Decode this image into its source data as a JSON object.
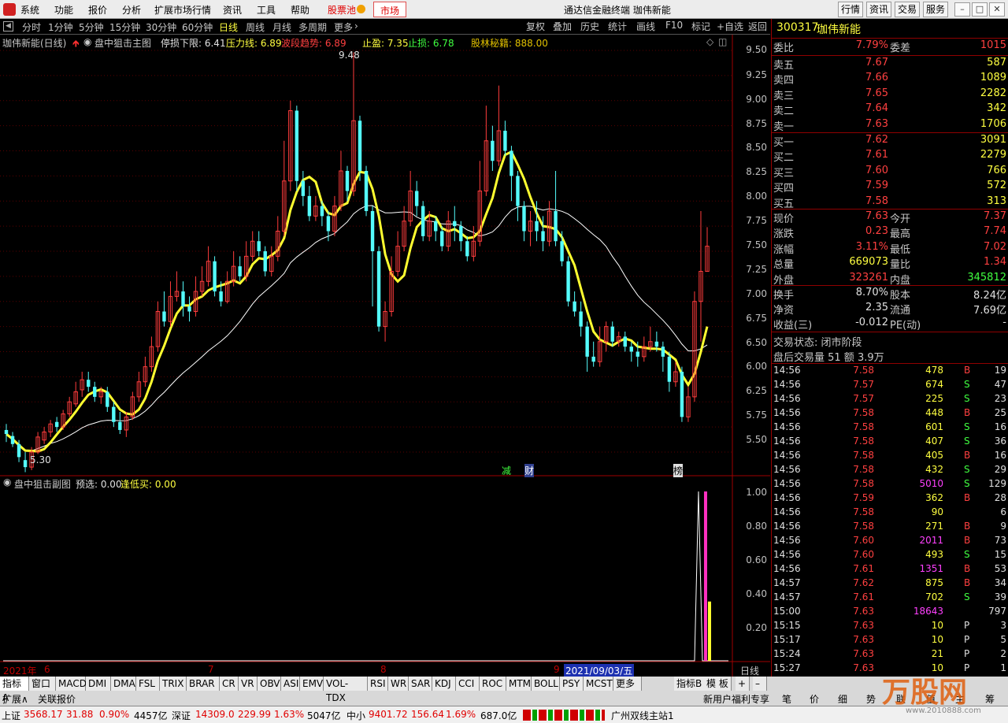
{
  "menubar": {
    "items": [
      "系统",
      "功能",
      "报价",
      "分析",
      "扩展市场行情",
      "资讯",
      "工具",
      "帮助"
    ],
    "stock_pool": "股票池",
    "market": "市场",
    "app_title": "通达信金融终端 珈伟新能",
    "right_buttons": [
      "行情",
      "资讯",
      "交易",
      "服务"
    ]
  },
  "periods": {
    "items": [
      "分时",
      "1分钟",
      "5分钟",
      "15分钟",
      "30分钟",
      "60分钟",
      "日线",
      "周线",
      "月线",
      "多周期",
      "更多"
    ],
    "active": "日线"
  },
  "chart_tools": [
    "复权",
    "叠加",
    "历史",
    "统计",
    "画线",
    "F10",
    "标记",
    "+自选",
    "返回"
  ],
  "main_legend": {
    "stock": "珈伟新能(日线)",
    "indicator": "盘中狙击主图",
    "stop_lower": "停损下限: 6.41",
    "pressure": "压力线: 6.89",
    "wave": "波段趋势: 6.89",
    "take_profit": "止盈: 7.35",
    "stop_loss": "止损: 6.78",
    "bollinger": "股林秘籍: 888.00"
  },
  "sub_legend": {
    "indicator": "盘中狙击副图",
    "preselect": "预选: 0.00",
    "buy_low": "逢低买: 0.00"
  },
  "price_axis": [
    "9.50",
    "9.25",
    "9.00",
    "8.75",
    "8.50",
    "8.25",
    "8.00",
    "7.75",
    "7.50",
    "7.25",
    "7.00",
    "6.75",
    "6.50",
    "6.25",
    "6.00",
    "5.75",
    "5.50"
  ],
  "sub_axis": [
    "1.00",
    "0.80",
    "0.60",
    "0.40",
    "0.20"
  ],
  "annotations": {
    "high": "9.48",
    "low": "5.30",
    "reduce": "减",
    "finance": "财",
    "rank": "榜"
  },
  "date_axis": {
    "year": "2021年",
    "months": [
      "6",
      "7",
      "8",
      "9"
    ],
    "cursor_date": "2021/09/03/五",
    "period_label": "日线"
  },
  "chart_data": {
    "type": "candlestick",
    "ylim": [
      5.3,
      9.6
    ],
    "candles": [
      [
        5.72,
        5.68,
        5.78,
        5.6
      ],
      [
        5.66,
        5.58,
        5.7,
        5.55
      ],
      [
        5.58,
        5.45,
        5.62,
        5.4
      ],
      [
        5.42,
        5.35,
        5.5,
        5.3
      ],
      [
        5.35,
        5.5,
        5.55,
        5.32
      ],
      [
        5.5,
        5.65,
        5.7,
        5.48
      ],
      [
        5.62,
        5.7,
        5.75,
        5.58
      ],
      [
        5.7,
        5.78,
        5.82,
        5.65
      ],
      [
        5.8,
        5.75,
        5.85,
        5.7
      ],
      [
        5.75,
        5.88,
        5.92,
        5.72
      ],
      [
        5.88,
        6.0,
        6.05,
        5.85
      ],
      [
        5.98,
        6.1,
        6.2,
        5.95
      ],
      [
        6.12,
        6.22,
        6.3,
        6.05
      ],
      [
        6.22,
        6.15,
        6.3,
        6.1
      ],
      [
        6.15,
        6.05,
        6.2,
        6.0
      ],
      [
        6.05,
        6.1,
        6.15,
        5.98
      ],
      [
        6.1,
        5.95,
        6.15,
        5.9
      ],
      [
        5.95,
        5.8,
        6.0,
        5.75
      ],
      [
        5.8,
        5.72,
        5.9,
        5.68
      ],
      [
        5.72,
        5.85,
        5.9,
        5.65
      ],
      [
        5.85,
        6.05,
        6.1,
        5.82
      ],
      [
        6.05,
        6.2,
        6.3,
        6.0
      ],
      [
        6.2,
        6.35,
        6.45,
        6.15
      ],
      [
        6.35,
        6.55,
        6.65,
        6.3
      ],
      [
        6.55,
        6.9,
        7.0,
        6.5
      ],
      [
        6.9,
        6.8,
        7.1,
        6.75
      ],
      [
        6.8,
        7.05,
        7.2,
        6.75
      ],
      [
        7.05,
        7.1,
        7.3,
        7.0
      ],
      [
        7.1,
        6.95,
        7.2,
        6.85
      ],
      [
        6.95,
        6.9,
        7.05,
        6.8
      ],
      [
        6.9,
        7.1,
        7.25,
        6.85
      ],
      [
        7.1,
        7.2,
        7.35,
        7.05
      ],
      [
        7.2,
        7.4,
        7.55,
        7.15
      ],
      [
        7.4,
        7.1,
        7.45,
        7.05
      ],
      [
        7.1,
        7.0,
        7.2,
        6.95
      ],
      [
        7.0,
        7.2,
        7.3,
        6.98
      ],
      [
        7.2,
        7.35,
        7.5,
        7.15
      ],
      [
        7.35,
        7.25,
        7.45,
        7.2
      ],
      [
        7.25,
        7.45,
        7.6,
        7.2
      ],
      [
        7.45,
        7.6,
        7.7,
        7.4
      ],
      [
        7.6,
        7.5,
        7.7,
        7.45
      ],
      [
        7.5,
        7.3,
        7.55,
        7.25
      ],
      [
        7.3,
        7.45,
        7.55,
        7.25
      ],
      [
        7.45,
        7.7,
        7.85,
        7.4
      ],
      [
        7.7,
        8.2,
        8.6,
        7.65
      ],
      [
        8.2,
        8.9,
        9.0,
        8.1
      ],
      [
        8.9,
        8.2,
        8.95,
        8.1
      ],
      [
        8.2,
        8.05,
        8.3,
        7.95
      ],
      [
        8.05,
        7.85,
        8.15,
        7.8
      ],
      [
        7.85,
        7.95,
        8.05,
        7.8
      ],
      [
        7.95,
        7.85,
        8.0,
        7.75
      ],
      [
        7.85,
        7.7,
        7.9,
        7.6
      ],
      [
        7.7,
        7.95,
        8.05,
        7.65
      ],
      [
        7.95,
        8.3,
        8.5,
        7.9
      ],
      [
        8.3,
        8.1,
        8.35,
        8.0
      ],
      [
        8.1,
        8.8,
        9.48,
        8.05
      ],
      [
        8.8,
        8.3,
        8.85,
        8.2
      ],
      [
        8.3,
        7.9,
        8.35,
        7.85
      ],
      [
        7.9,
        7.5,
        7.95,
        6.95
      ],
      [
        7.5,
        6.75,
        7.55,
        6.7
      ],
      [
        6.75,
        6.9,
        7.0,
        6.6
      ],
      [
        6.9,
        7.3,
        7.45,
        6.85
      ],
      [
        7.3,
        7.55,
        7.7,
        7.25
      ],
      [
        7.55,
        7.8,
        7.95,
        7.5
      ],
      [
        7.8,
        8.1,
        8.3,
        7.75
      ],
      [
        8.1,
        7.95,
        8.2,
        7.85
      ],
      [
        7.95,
        7.65,
        8.0,
        7.6
      ],
      [
        7.65,
        7.8,
        7.9,
        7.6
      ],
      [
        7.8,
        7.7,
        7.85,
        7.6
      ],
      [
        7.7,
        7.55,
        7.75,
        7.5
      ],
      [
        7.55,
        7.8,
        7.9,
        7.5
      ],
      [
        7.8,
        7.75,
        7.95,
        7.6
      ],
      [
        7.75,
        7.6,
        7.8,
        7.5
      ],
      [
        7.6,
        7.45,
        7.65,
        7.4
      ],
      [
        7.45,
        7.6,
        7.75,
        7.4
      ],
      [
        7.6,
        8.1,
        8.4,
        7.55
      ],
      [
        8.1,
        8.6,
        8.95,
        8.05
      ],
      [
        8.6,
        8.4,
        8.75,
        8.3
      ],
      [
        8.4,
        8.7,
        9.15,
        8.35
      ],
      [
        8.7,
        8.5,
        8.8,
        8.45
      ],
      [
        8.5,
        8.25,
        8.55,
        8.0
      ],
      [
        8.25,
        7.95,
        8.3,
        7.8
      ],
      [
        7.95,
        7.7,
        8.0,
        7.6
      ],
      [
        7.7,
        7.8,
        7.9,
        7.55
      ],
      [
        7.8,
        7.7,
        8.0,
        7.6
      ],
      [
        7.7,
        7.6,
        7.85,
        7.5
      ],
      [
        7.6,
        7.9,
        8.0,
        7.55
      ],
      [
        7.9,
        7.6,
        8.3,
        7.55
      ],
      [
        7.6,
        7.4,
        7.7,
        7.35
      ],
      [
        7.4,
        7.0,
        7.45,
        6.95
      ],
      [
        7.0,
        6.9,
        7.1,
        6.85
      ],
      [
        6.9,
        6.75,
        7.0,
        6.65
      ],
      [
        6.75,
        6.45,
        6.8,
        6.3
      ],
      [
        6.45,
        6.4,
        6.6,
        6.35
      ],
      [
        6.4,
        6.6,
        6.75,
        6.35
      ],
      [
        6.6,
        6.75,
        6.8,
        6.5
      ],
      [
        6.75,
        6.6,
        6.8,
        6.55
      ],
      [
        6.6,
        6.65,
        6.7,
        6.55
      ],
      [
        6.65,
        6.55,
        6.7,
        6.5
      ],
      [
        6.55,
        6.5,
        6.6,
        6.4
      ],
      [
        6.5,
        6.45,
        6.6,
        6.35
      ],
      [
        6.45,
        6.55,
        6.65,
        6.4
      ],
      [
        6.55,
        6.6,
        6.75,
        6.5
      ],
      [
        6.6,
        6.55,
        6.7,
        6.5
      ],
      [
        6.55,
        6.45,
        6.6,
        6.3
      ],
      [
        6.45,
        6.2,
        6.5,
        6.1
      ],
      [
        6.2,
        6.3,
        6.4,
        6.15
      ],
      [
        6.3,
        5.85,
        6.35,
        5.8
      ],
      [
        5.85,
        6.05,
        6.15,
        5.8
      ],
      [
        6.05,
        7.0,
        7.1,
        6.0
      ],
      [
        7.0,
        7.3,
        7.9,
        6.6
      ],
      [
        7.3,
        7.55,
        7.74,
        7.3
      ]
    ]
  },
  "quote": {
    "code": "300317",
    "name": "珈伟新能",
    "weibi": {
      "label": "委比",
      "value": "7.79%"
    },
    "weicha": {
      "label": "委差",
      "value": "1015"
    },
    "asks": [
      {
        "label": "卖五",
        "price": "7.67",
        "vol": "587"
      },
      {
        "label": "卖四",
        "price": "7.66",
        "vol": "1089"
      },
      {
        "label": "卖三",
        "price": "7.65",
        "vol": "2282"
      },
      {
        "label": "卖二",
        "price": "7.64",
        "vol": "342"
      },
      {
        "label": "卖一",
        "price": "7.63",
        "vol": "1706"
      }
    ],
    "bids": [
      {
        "label": "买一",
        "price": "7.62",
        "vol": "3091"
      },
      {
        "label": "买二",
        "price": "7.61",
        "vol": "2279"
      },
      {
        "label": "买三",
        "price": "7.60",
        "vol": "766"
      },
      {
        "label": "买四",
        "price": "7.59",
        "vol": "572"
      },
      {
        "label": "买五",
        "price": "7.58",
        "vol": "313"
      }
    ],
    "stats": [
      {
        "l1": "现价",
        "v1": "7.63",
        "l2": "今开",
        "v2": "7.37"
      },
      {
        "l1": "涨跌",
        "v1": "0.23",
        "l2": "最高",
        "v2": "7.74"
      },
      {
        "l1": "涨幅",
        "v1": "3.11%",
        "l2": "最低",
        "v2": "7.02"
      },
      {
        "l1": "总量",
        "v1": "669073",
        "l2": "量比",
        "v2": "1.34"
      },
      {
        "l1": "外盘",
        "v1": "323261",
        "l2": "内盘",
        "v2": "345812"
      }
    ],
    "stats2": [
      {
        "l1": "换手",
        "v1": "8.70%",
        "l2": "股本",
        "v2": "8.24亿"
      },
      {
        "l1": "净资",
        "v1": "2.35",
        "l2": "流通",
        "v2": "7.69亿"
      },
      {
        "l1": "收益(三)",
        "v1": "-0.012",
        "l2": "PE(动)",
        "v2": "-"
      }
    ],
    "status": "交易状态: 闭市阶段",
    "after_hours": "盘后交易量 51 额 3.9万"
  },
  "ticks": [
    [
      "14:56",
      "7.58",
      "478",
      "B",
      "19"
    ],
    [
      "14:56",
      "7.57",
      "674",
      "S",
      "47"
    ],
    [
      "14:56",
      "7.57",
      "225",
      "S",
      "23"
    ],
    [
      "14:56",
      "7.58",
      "448",
      "B",
      "25"
    ],
    [
      "14:56",
      "7.58",
      "601",
      "S",
      "16"
    ],
    [
      "14:56",
      "7.58",
      "407",
      "S",
      "36"
    ],
    [
      "14:56",
      "7.58",
      "405",
      "B",
      "16"
    ],
    [
      "14:56",
      "7.58",
      "432",
      "S",
      "29"
    ],
    [
      "14:56",
      "7.58",
      "5010",
      "S",
      "129"
    ],
    [
      "14:56",
      "7.59",
      "362",
      "B",
      "28"
    ],
    [
      "14:56",
      "7.58",
      "90",
      "",
      "6"
    ],
    [
      "14:56",
      "7.58",
      "271",
      "B",
      "9"
    ],
    [
      "14:56",
      "7.60",
      "2011",
      "B",
      "73"
    ],
    [
      "14:56",
      "7.60",
      "493",
      "S",
      "15"
    ],
    [
      "14:56",
      "7.61",
      "1351",
      "B",
      "53"
    ],
    [
      "14:57",
      "7.62",
      "875",
      "B",
      "34"
    ],
    [
      "14:57",
      "7.61",
      "702",
      "S",
      "39"
    ],
    [
      "15:00",
      "7.63",
      "18643",
      "",
      "797"
    ],
    [
      "15:15",
      "7.63",
      "10",
      "P",
      "3"
    ],
    [
      "15:17",
      "7.63",
      "10",
      "P",
      "5"
    ],
    [
      "15:24",
      "7.63",
      "21",
      "P",
      "2"
    ],
    [
      "15:27",
      "7.63",
      "10",
      "P",
      "1"
    ]
  ],
  "indicator_tabs": [
    "指标A",
    "窗口",
    "MACD",
    "DMI",
    "DMA",
    "FSL",
    "TRIX",
    "BRAR",
    "CR",
    "VR",
    "OBV",
    "ASI",
    "EMV",
    "VOL-TDX",
    "RSI",
    "WR",
    "SAR",
    "KDJ",
    "CCI",
    "ROC",
    "MTM",
    "BOLL",
    "PSY",
    "MCST",
    "更多"
  ],
  "indicator_b": "指标B",
  "template": "模 板",
  "expand": "扩展∧",
  "linked": "关联报价",
  "right_tabs": [
    "新用户福利专享",
    "笔",
    "价",
    "细",
    "势",
    "联",
    "值",
    "主",
    "筹"
  ],
  "statusbar": {
    "sh_label": "上证",
    "sh": "3568.17",
    "sh_chg": "31.88",
    "sh_pct": "0.90%",
    "sh_amt": "4457亿",
    "sz_label": "深证",
    "sz": "14309.0",
    "sz_chg": "229.99",
    "sz_pct": "1.63%",
    "sz_amt": "5047亿",
    "zx_label": "中小",
    "zx": "9401.72",
    "zx_chg": "156.64",
    "zx_pct": "1.69%",
    "zx_amt": "687.0亿",
    "server": "广州双线主站1"
  },
  "watermark": "万股网",
  "watermark_url": "www.2010888.com"
}
